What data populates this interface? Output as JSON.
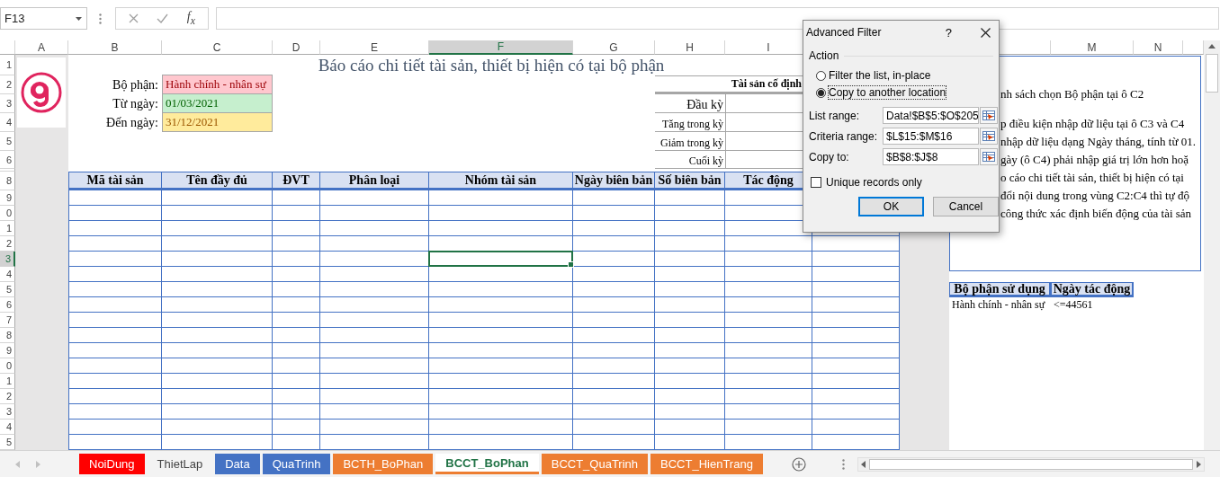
{
  "formula_bar": {
    "name_box": "F13",
    "function_label": "f$_{x}$"
  },
  "columns": [
    {
      "label": "A",
      "selected": false
    },
    {
      "label": "B",
      "selected": false
    },
    {
      "label": "C",
      "selected": false
    },
    {
      "label": "D",
      "selected": false
    },
    {
      "label": "E",
      "selected": false
    },
    {
      "label": "F",
      "selected": true
    },
    {
      "label": "G",
      "selected": false
    },
    {
      "label": "H",
      "selected": false
    },
    {
      "label": "I",
      "selected": false
    },
    {
      "label": "M",
      "selected": false
    },
    {
      "label": "N",
      "selected": false
    }
  ],
  "rows": [
    {
      "label": "1",
      "selected": false
    },
    {
      "label": "2",
      "selected": false
    },
    {
      "label": "3",
      "selected": false
    },
    {
      "label": "4",
      "selected": false
    },
    {
      "label": "5",
      "selected": false
    },
    {
      "label": "6",
      "selected": false
    },
    {
      "label": "8",
      "selected": false
    },
    {
      "label": "9",
      "selected": false
    },
    {
      "label": "0",
      "selected": false
    },
    {
      "label": "1",
      "selected": false
    },
    {
      "label": "2",
      "selected": false
    },
    {
      "label": "3",
      "selected": true
    },
    {
      "label": "4",
      "selected": false
    },
    {
      "label": "5",
      "selected": false
    },
    {
      "label": "6",
      "selected": false
    },
    {
      "label": "7",
      "selected": false
    },
    {
      "label": "8",
      "selected": false
    },
    {
      "label": "9",
      "selected": false
    },
    {
      "label": "0",
      "selected": false
    },
    {
      "label": "1",
      "selected": false
    },
    {
      "label": "2",
      "selected": false
    },
    {
      "label": "3",
      "selected": false
    },
    {
      "label": "4",
      "selected": false
    },
    {
      "label": "5",
      "selected": false
    }
  ],
  "report": {
    "title": "Báo cáo chi tiết tài sản, thiết bị hiện có tại bộ phận",
    "filters": [
      {
        "label": "Bộ phận:",
        "value": "Hành chính - nhân sự",
        "color": "#ffc7ce"
      },
      {
        "label": "Từ ngày:",
        "value": "01/03/2021",
        "color": "#c6efce"
      },
      {
        "label": "Đến ngày:",
        "value": "31/12/2021",
        "color": "#ffeb9c"
      }
    ],
    "summary": {
      "title": "Tài sản cố định",
      "rows": [
        "Đầu kỳ",
        "Tăng trong kỳ",
        "Giảm trong kỳ",
        "Cuối kỳ"
      ]
    },
    "table": {
      "columns": [
        "Mã tài sản",
        "Tên đầy đủ",
        "ĐVT",
        "Phân loại",
        "Nhóm tài sản",
        "Ngày biên bản",
        "Số biên bản",
        "Tác động"
      ]
    }
  },
  "note_box": {
    "paragraphs": [
      [
        "nh sách chọn Bộ phận tại ô C2"
      ],
      [
        "p điều kiện nhập dữ liệu tại ô C3 và C4",
        "nhập dữ liệu dạng Ngày tháng, tính từ 01.",
        "gày (ô C4) phải nhập giá trị lớn hơn hoặ",
        "o cáo chi tiết tài sản, thiết bị hiện có tại",
        "đổi nội dung trong vùng C2:C4 thì tự độ",
        "công thức xác định biến động của tài sản"
      ]
    ]
  },
  "criteria": {
    "columns": [
      "Bộ phận sử dụng",
      "Ngày tác động"
    ],
    "rows": [
      [
        "Hành chính - nhân sự",
        "<=44561"
      ]
    ]
  },
  "dialog": {
    "title": "Advanced Filter",
    "help": "?",
    "group": "Action",
    "options": [
      {
        "label": "Filter the list, in-place",
        "selected": false
      },
      {
        "label": "Copy to another location",
        "selected": true
      }
    ],
    "fields": [
      {
        "label": "List range:",
        "value": "Data!$B$5:$O$205"
      },
      {
        "label": "Criteria range:",
        "value": "$L$15:$M$16"
      },
      {
        "label": "Copy to:",
        "value": "$B$8:$J$8"
      }
    ],
    "checkbox": {
      "label": "Unique records only",
      "checked": false
    },
    "buttons": [
      {
        "label": "OK",
        "default": true
      },
      {
        "label": "Cancel",
        "default": false
      }
    ]
  },
  "sheet_tabs": [
    {
      "label": "NoiDung",
      "color": "#ff0000",
      "selected": false
    },
    {
      "label": "ThietLap",
      "selected": false
    },
    {
      "label": "Data",
      "color": "#4472c4",
      "selected": false
    },
    {
      "label": "QuaTrinh",
      "color": "#4472c4",
      "selected": false
    },
    {
      "label": "BCTH_BoPhan",
      "color": "#ed7d31",
      "selected": false
    },
    {
      "label": "BCCT_BoPhan",
      "color": "#ed7d31",
      "selected": true
    },
    {
      "label": "BCCT_QuaTrinh",
      "color": "#ed7d31",
      "selected": false
    },
    {
      "label": "BCCT_HienTrang",
      "color": "#ed7d31",
      "selected": false
    }
  ]
}
